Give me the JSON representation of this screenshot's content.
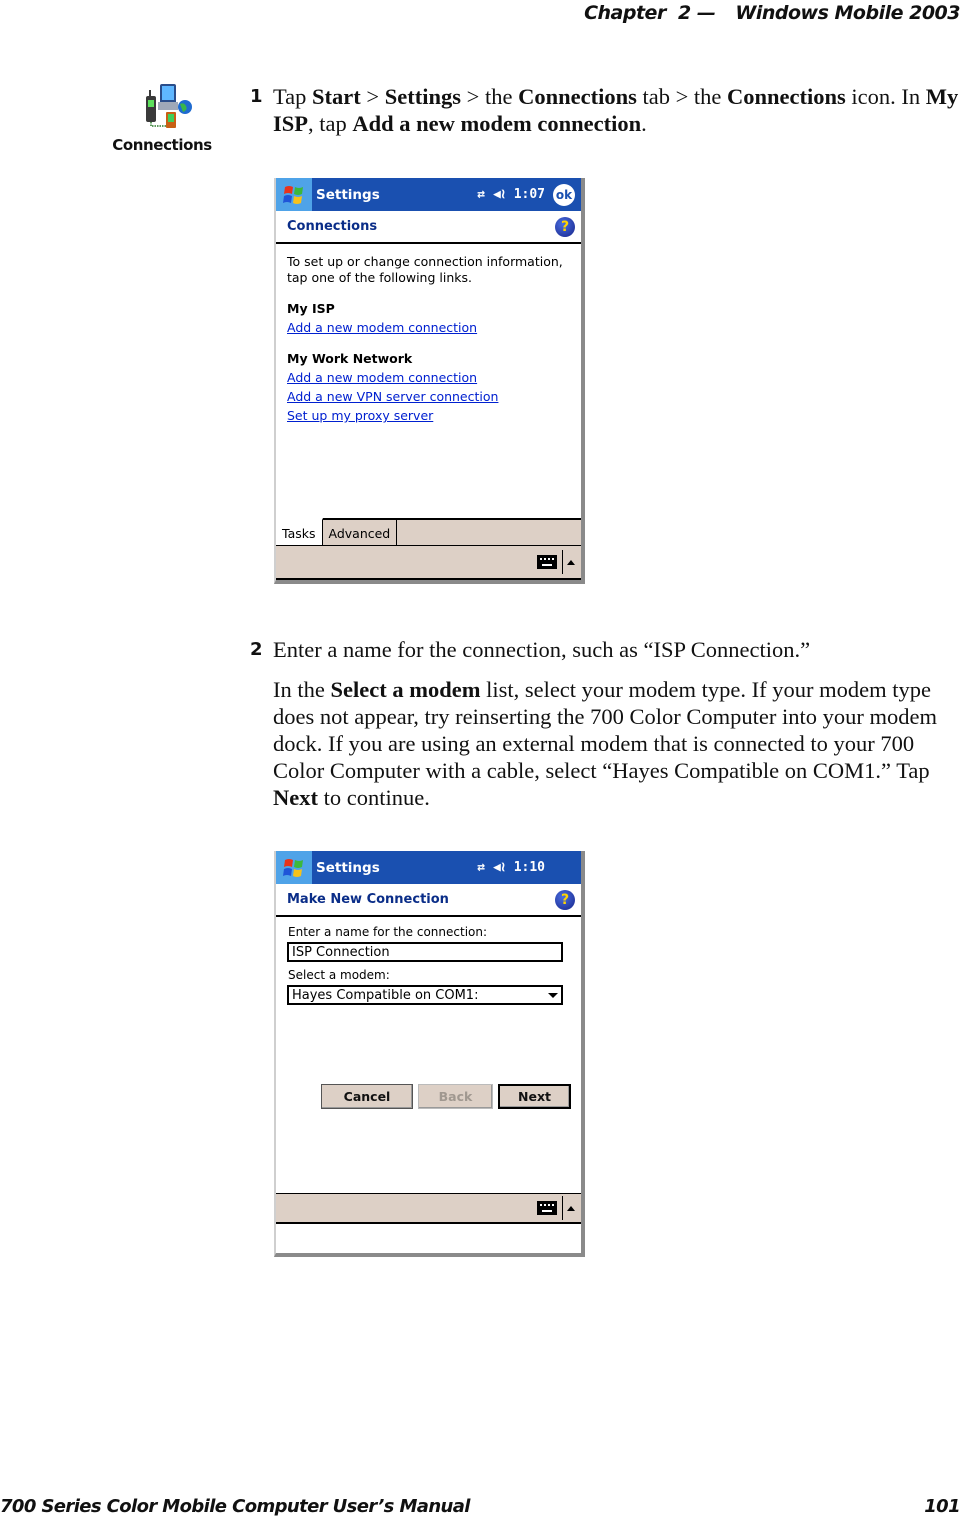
{
  "header": {
    "chapter": "Chapter  2",
    "dash": "—",
    "title": "Windows Mobile 2003"
  },
  "footer": {
    "manual": "700 Series Color Mobile Computer User’s Manual",
    "page": "101"
  },
  "margin_icon": {
    "icon": "connections-icon",
    "caption": "Connections"
  },
  "step1": {
    "number": "1",
    "t1": "Tap ",
    "b1": "Start",
    "t2": " > ",
    "b2": "Settings",
    "t3": " > the ",
    "b3": "Connections",
    "t4": " tab > the ",
    "b4": "Connections",
    "t5": " icon. In ",
    "b5": "My ISP",
    "t6": ", tap ",
    "b6": "Add a new modem connection",
    "t7": "."
  },
  "step2": {
    "number": "2",
    "para1": "Enter a name for the connection, such as “ISP Connection.”",
    "p2_t1": "In the ",
    "p2_b1": "Select a modem",
    "p2_t2": " list, select your modem type. If your modem type does not appear, try reinserting the 700 Color Computer into your modem dock. If you are using an external modem that is connected to your 700 Color Computer with a cable, select “Hayes Compatible on COM1.” Tap ",
    "p2_b2": "Next",
    "p2_t3": " to continue."
  },
  "shot1": {
    "titlebar": {
      "title": "Settings",
      "time": "1:07",
      "ok": "ok",
      "icons": [
        "windows-start-icon",
        "connectivity-icon",
        "speaker-icon",
        "ok-icon"
      ]
    },
    "subhead": "Connections",
    "intro": "To set up or change connection information, tap one of the following links.",
    "groups": [
      {
        "title": "My ISP",
        "links": [
          "Add a new modem connection"
        ]
      },
      {
        "title": "My Work Network",
        "links": [
          "Add a new modem connection",
          "Add a new VPN server connection",
          "Set up my proxy server"
        ]
      }
    ],
    "tabs": [
      "Tasks",
      "Advanced"
    ],
    "active_tab": "Tasks"
  },
  "shot2": {
    "titlebar": {
      "title": "Settings",
      "time": "1:10",
      "icons": [
        "windows-start-icon",
        "connectivity-icon",
        "speaker-icon"
      ]
    },
    "subhead": "Make New Connection",
    "name_label": "Enter a name for the connection:",
    "name_value": "ISP Connection",
    "modem_label": "Select a modem:",
    "modem_value": "Hayes Compatible on COM1:",
    "buttons": {
      "cancel": "Cancel",
      "back": "Back",
      "next": "Next"
    }
  },
  "colors": {
    "titlebar": "#1a50b0",
    "start_button": "#4fa3e8",
    "subhead_text": "#0a2d88",
    "link": "#0020d0",
    "bar_bg": "#ddd0c6"
  }
}
